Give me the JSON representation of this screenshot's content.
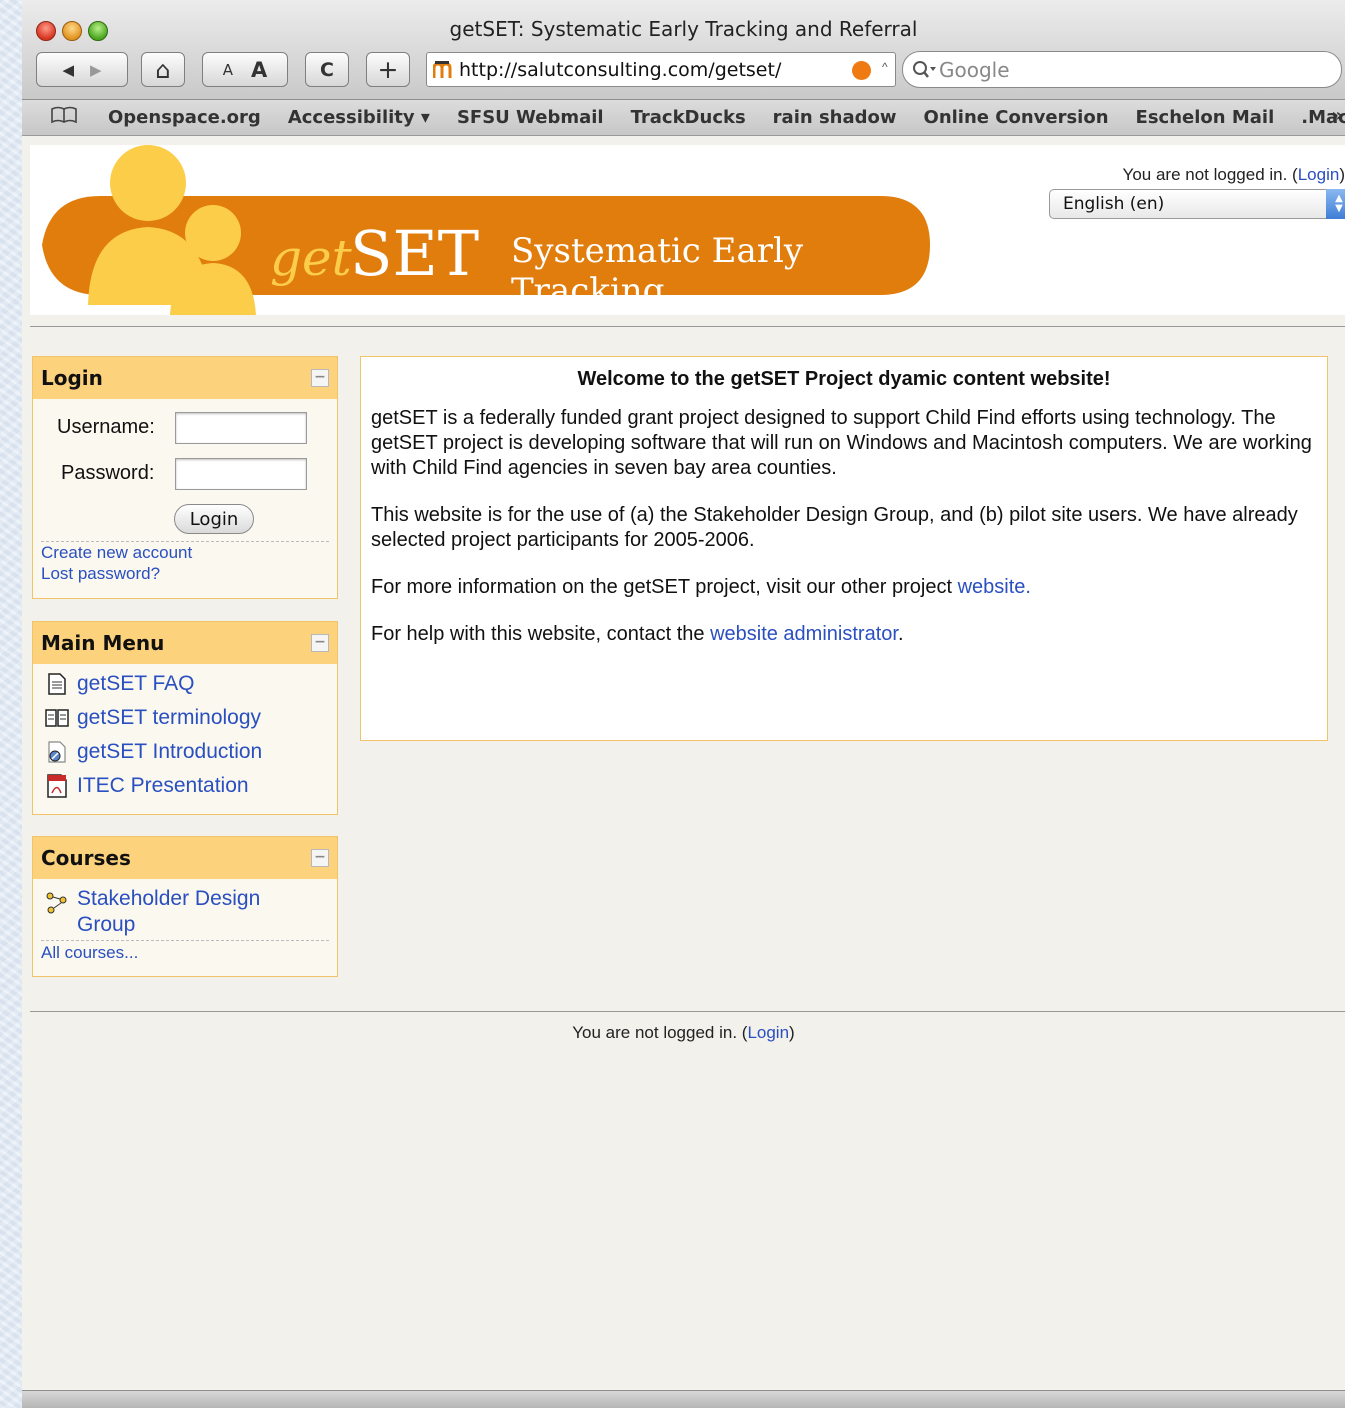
{
  "window": {
    "title": "getSET: Systematic Early Tracking and Referral"
  },
  "toolbar": {
    "back_icon": "◀",
    "forward_icon": "▶",
    "home_icon": "⌂",
    "text_smaller": "A",
    "text_larger": "A",
    "reload_icon": "C",
    "add_icon": "+",
    "url": "http://salutconsulting.com/getset/",
    "search_placeholder": "Google"
  },
  "bookmarks": {
    "items": [
      "Openspace.org",
      "Accessibility ▾",
      "SFSU Webmail",
      "TrackDucks",
      "rain shadow",
      "Online Conversion",
      "Eschelon Mail",
      ".Mac"
    ],
    "more": "»"
  },
  "header": {
    "logo_get": "get",
    "logo_set": "SET",
    "logo_tagline": "Systematic Early Tracking",
    "login_status": "You are not logged in. (",
    "login_link": "Login",
    "login_close": ")",
    "language": "English (en)"
  },
  "login_block": {
    "title": "Login",
    "username_label": "Username:",
    "password_label": "Password:",
    "button": "Login",
    "create_account": "Create new account",
    "lost_password": "Lost password?"
  },
  "main_menu": {
    "title": "Main Menu",
    "items": [
      "getSET FAQ",
      "getSET terminology",
      "getSET Introduction",
      "ITEC Presentation"
    ]
  },
  "courses": {
    "title": "Courses",
    "course_line1": "Stakeholder Design",
    "course_line2": "Group",
    "all_courses": "All courses..."
  },
  "content": {
    "heading": "Welcome to the getSET Project dyamic content website!",
    "p1": "getSET is a federally funded grant project designed to support Child Find efforts using technology. The getSET project is developing software that will run on Windows and Macintosh computers. We are working with Child Find agencies in seven bay area counties.",
    "p2": "This website is for the use of (a) the Stakeholder Design Group, and (b) pilot site users. We have already selected project participants for 2005-2006.",
    "p3_text": "For more information on the getSET project, visit our other project ",
    "p3_link": "website.",
    "p4_text": "For help with this website, contact the ",
    "p4_link": "website administrator",
    "p4_end": "."
  },
  "footer": {
    "login_status": "You are not logged in. (",
    "login_link": "Login",
    "login_close": ")"
  },
  "colors": {
    "accent_orange": "#e07d0c",
    "figure_yellow": "#fccd48",
    "block_header": "#fdd27c",
    "link_blue": "#2a4fc0"
  }
}
